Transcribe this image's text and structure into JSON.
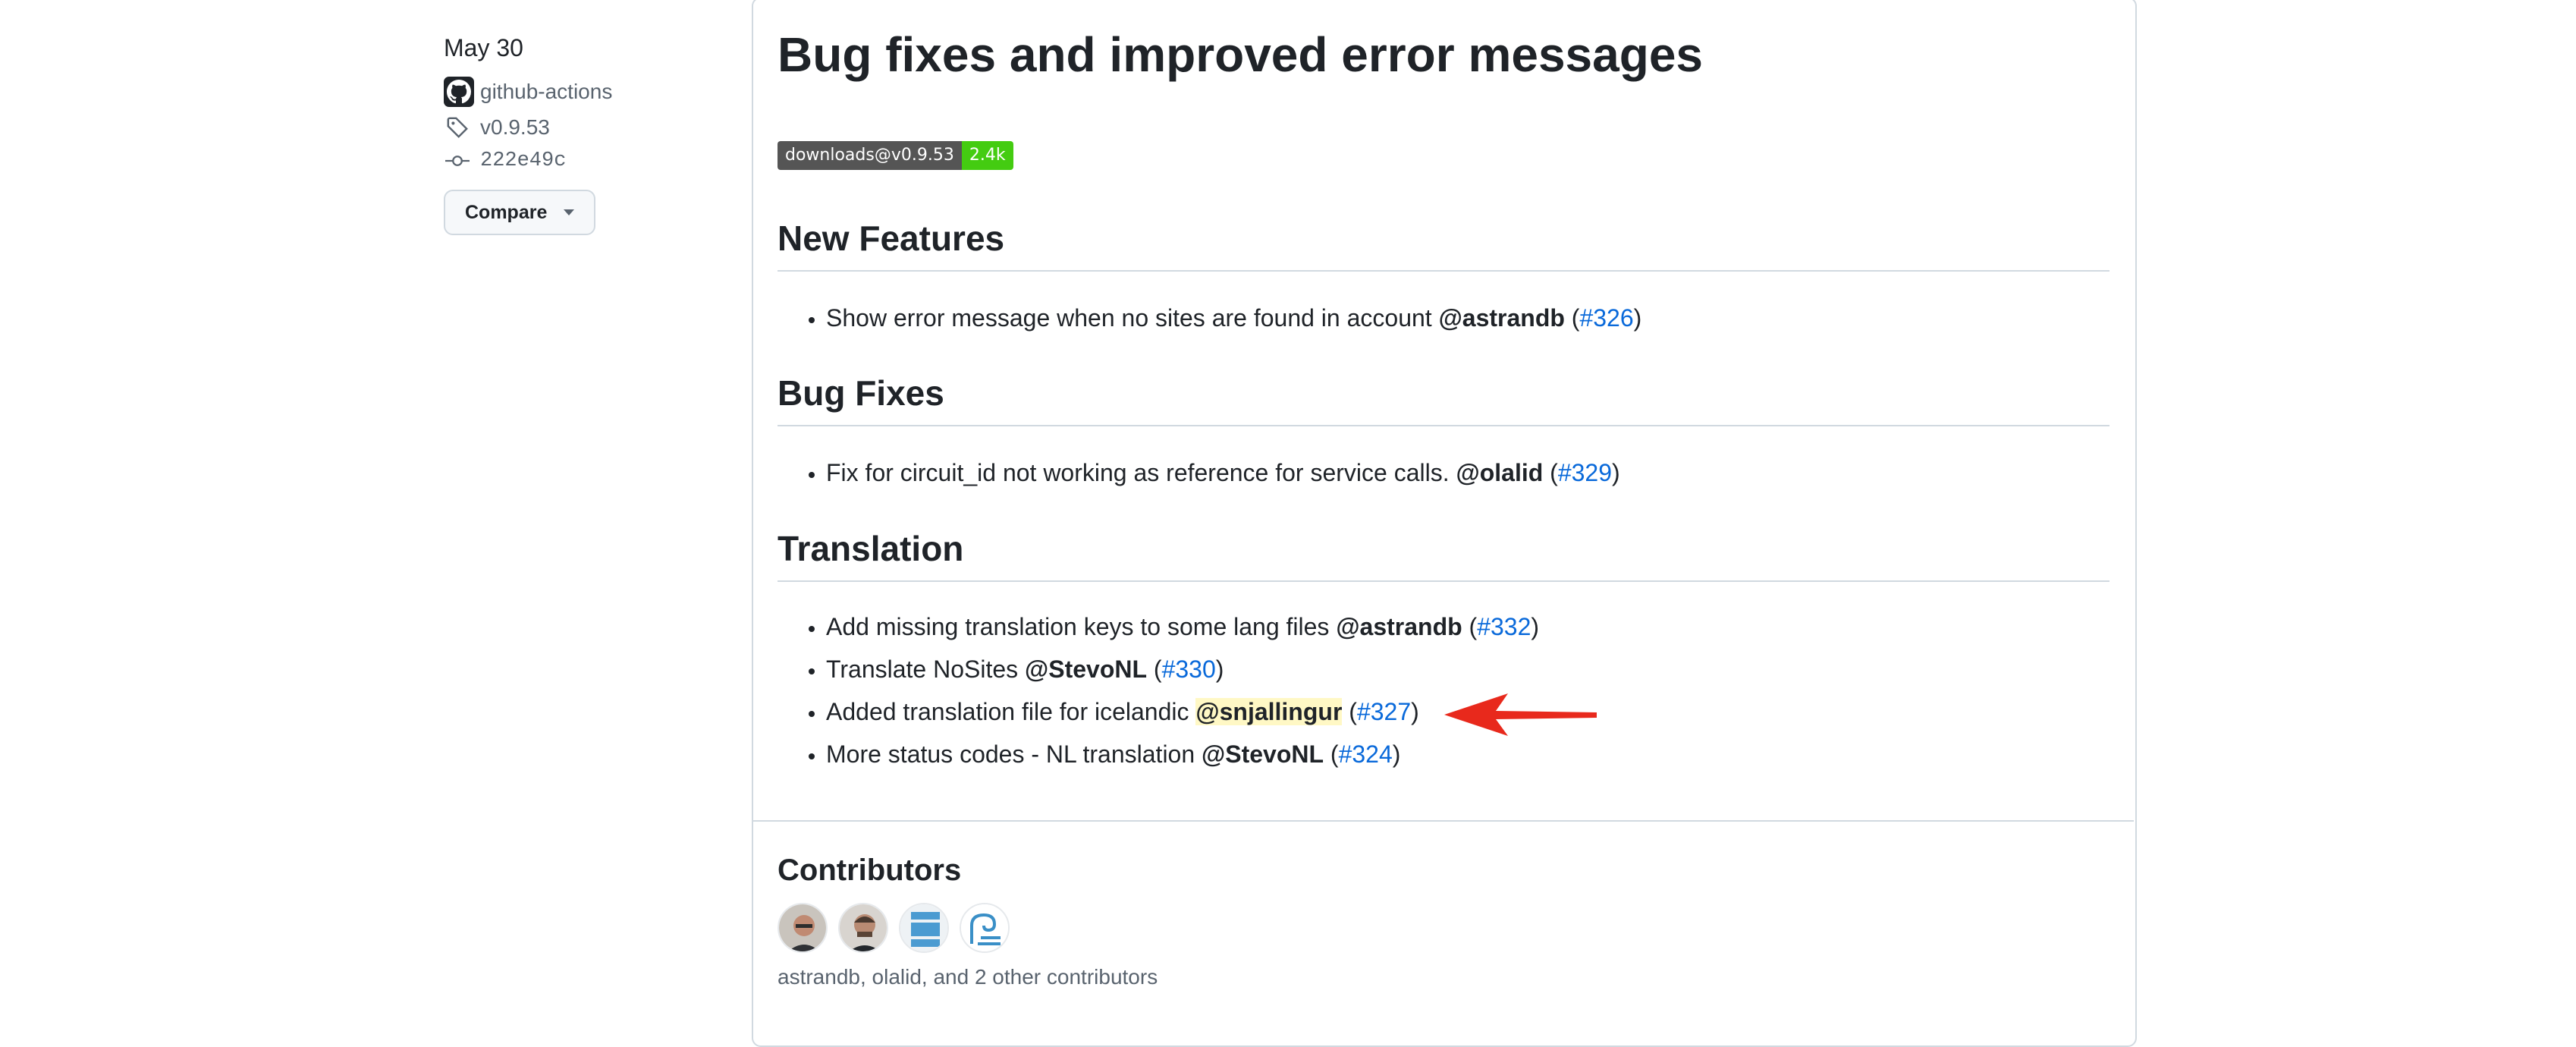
{
  "sidebar": {
    "date": "May 30",
    "author": "github-actions",
    "tag": "v0.9.53",
    "commit": "222e49c",
    "compare_label": "Compare"
  },
  "release": {
    "title": "Bug fixes and improved error messages",
    "badge": {
      "label": "downloads@v0.9.53",
      "value": "2.4k"
    },
    "sections": [
      {
        "heading": "New Features",
        "items": [
          {
            "text": "Show error message when no sites are found in account ",
            "mention": "@astrandb",
            "open": " (",
            "link": "#326",
            "close": ")"
          }
        ]
      },
      {
        "heading": "Bug Fixes",
        "items": [
          {
            "text": "Fix for circuit_id not working as reference for service calls. ",
            "mention": "@olalid",
            "open": " (",
            "link": "#329",
            "close": ")"
          }
        ]
      },
      {
        "heading": "Translation",
        "items": [
          {
            "text": "Add missing translation keys to some lang files ",
            "mention": "@astrandb",
            "open": " (",
            "link": "#332",
            "close": ")"
          },
          {
            "text": "Translate NoSites ",
            "mention": "@StevoNL",
            "open": " (",
            "link": "#330",
            "close": ")"
          },
          {
            "text": "Added translation file for icelandic ",
            "mention": "@snjallingur",
            "open": " (",
            "link": "#327",
            "close": ")"
          },
          {
            "text": "More status codes - NL translation ",
            "mention": "@StevoNL",
            "open": " (",
            "link": "#324",
            "close": ")"
          }
        ]
      }
    ]
  },
  "contributors": {
    "title": "Contributors",
    "summary": "astrandb, olalid, and 2 other contributors"
  },
  "colors": {
    "link": "#0969da",
    "highlight": "#fff8c5",
    "arrow": "#e8291c",
    "badge_green": "#44cc11"
  }
}
